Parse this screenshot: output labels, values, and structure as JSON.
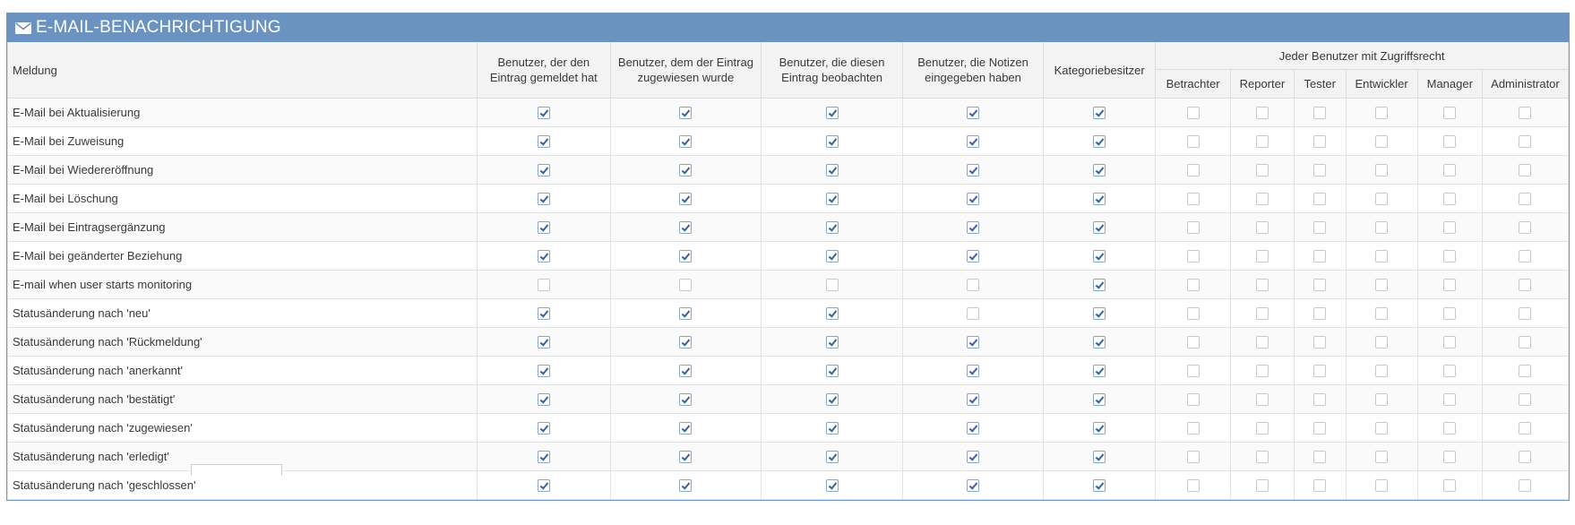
{
  "widget": {
    "title": "E-MAIL-BENACHRICHTIGUNG",
    "icon": "envelope-icon"
  },
  "columns": {
    "message": "Meldung",
    "reporter": "Benutzer, der den Eintrag gemeldet hat",
    "handler": "Benutzer, dem der Eintrag zugewiesen wurde",
    "monitor": "Benutzer, die diesen Eintrag beobachten",
    "notes": "Benutzer, die Notizen eingegeben haben",
    "category": "Kategoriebesitzer",
    "access_group": "Jeder Benutzer mit Zugriffsrecht",
    "levels": [
      "Betrachter",
      "Reporter",
      "Tester",
      "Entwickler",
      "Manager",
      "Administrator"
    ]
  },
  "rows": [
    {
      "label": "E-Mail bei Aktualisierung",
      "checks": [
        true,
        true,
        true,
        true,
        true,
        false,
        false,
        false,
        false,
        false,
        false
      ]
    },
    {
      "label": "E-Mail bei Zuweisung",
      "checks": [
        true,
        true,
        true,
        true,
        true,
        false,
        false,
        false,
        false,
        false,
        false
      ]
    },
    {
      "label": "E-Mail bei Wiedereröffnung",
      "checks": [
        true,
        true,
        true,
        true,
        true,
        false,
        false,
        false,
        false,
        false,
        false
      ]
    },
    {
      "label": "E-Mail bei Löschung",
      "checks": [
        true,
        true,
        true,
        true,
        true,
        false,
        false,
        false,
        false,
        false,
        false
      ]
    },
    {
      "label": "E-Mail bei Eintragsergänzung",
      "checks": [
        true,
        true,
        true,
        true,
        true,
        false,
        false,
        false,
        false,
        false,
        false
      ]
    },
    {
      "label": "E-Mail bei geänderter Beziehung",
      "checks": [
        true,
        true,
        true,
        true,
        true,
        false,
        false,
        false,
        false,
        false,
        false
      ]
    },
    {
      "label": "E-mail when user starts monitoring",
      "checks": [
        false,
        false,
        false,
        false,
        true,
        false,
        false,
        false,
        false,
        false,
        false
      ]
    },
    {
      "label": "Statusänderung nach 'neu'",
      "checks": [
        true,
        true,
        true,
        false,
        true,
        false,
        false,
        false,
        false,
        false,
        false
      ]
    },
    {
      "label": "Statusänderung nach 'Rückmeldung'",
      "checks": [
        true,
        true,
        true,
        true,
        true,
        false,
        false,
        false,
        false,
        false,
        false
      ]
    },
    {
      "label": "Statusänderung nach 'anerkannt'",
      "checks": [
        true,
        true,
        true,
        true,
        true,
        false,
        false,
        false,
        false,
        false,
        false
      ]
    },
    {
      "label": "Statusänderung nach 'bestätigt'",
      "checks": [
        true,
        true,
        true,
        true,
        true,
        false,
        false,
        false,
        false,
        false,
        false
      ]
    },
    {
      "label": "Statusänderung nach 'zugewiesen'",
      "checks": [
        true,
        true,
        true,
        true,
        true,
        false,
        false,
        false,
        false,
        false,
        false
      ]
    },
    {
      "label": "Statusänderung nach 'erledigt'",
      "checks": [
        true,
        true,
        true,
        true,
        true,
        false,
        false,
        false,
        false,
        false,
        false
      ]
    },
    {
      "label": "Statusänderung nach 'geschlossen'",
      "checks": [
        true,
        true,
        true,
        true,
        true,
        false,
        false,
        false,
        false,
        false,
        false
      ]
    }
  ]
}
